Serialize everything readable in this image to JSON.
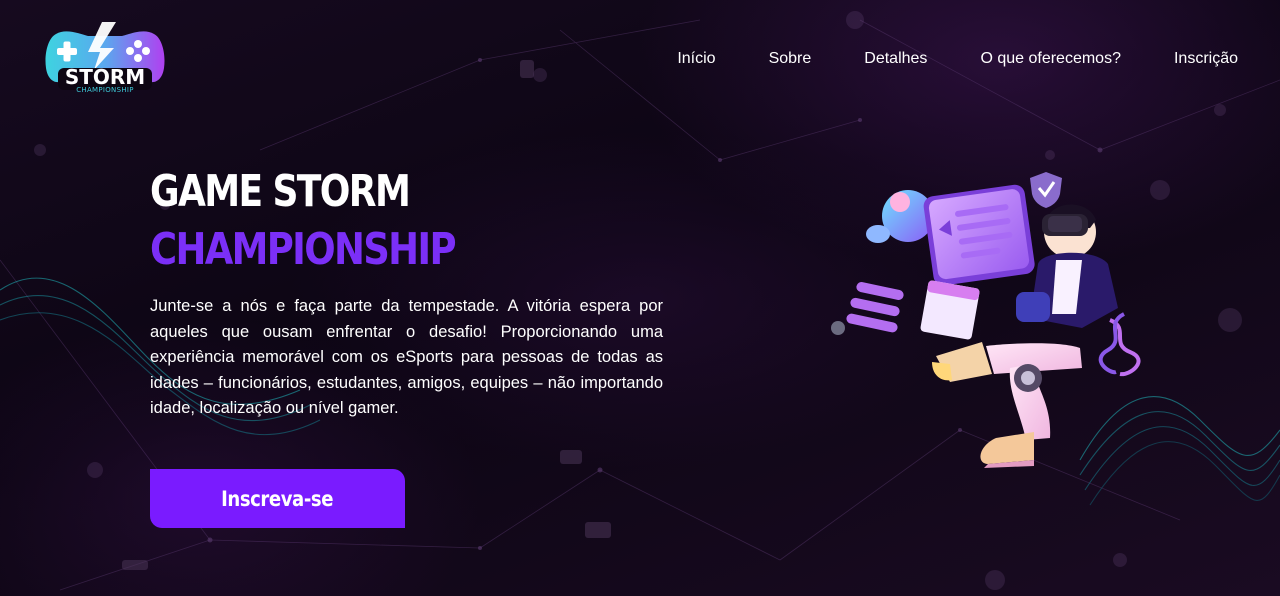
{
  "brand": {
    "logo_word": "STORM",
    "logo_sub": "CHAMPIONSHIP"
  },
  "nav": {
    "items": [
      {
        "label": "Início"
      },
      {
        "label": "Sobre"
      },
      {
        "label": "Detalhes"
      },
      {
        "label": "O que oferecemos?"
      },
      {
        "label": "Inscrição"
      }
    ]
  },
  "hero": {
    "title_line1": "GAME STORM",
    "title_line2": "CHAMPIONSHIP",
    "description": "Junte-se a nós e faça parte da tempestade. A vitória espera por aqueles que ousam enfrentar o desafio! Proporcionando uma experiência memorável com os eSports para pessoas de todas as idades – funcionários, estudantes, amigos, equipes – não importando idade, localização ou nível gamer.",
    "cta_label": "Inscreva-se"
  },
  "colors": {
    "accent": "#7a1bff",
    "title_purple": "#7b2ff7",
    "logo_cyan": "#3ec8d8",
    "logo_purple": "#a03cf0",
    "background": "#0d0612"
  },
  "icons": {
    "logo": "gamepad-storm-logo",
    "illustration": "vr-gamer-illustration"
  }
}
